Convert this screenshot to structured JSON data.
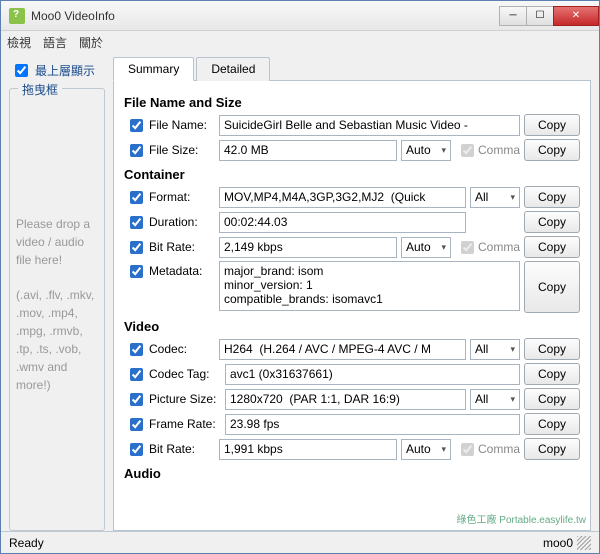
{
  "window": {
    "title": "Moo0 VideoInfo"
  },
  "menu": {
    "view": "檢視",
    "language": "語言",
    "about": "關於"
  },
  "sidebar": {
    "topmost": "最上層顯示",
    "dropframe_legend": "拖曳框",
    "drop_line1": "Please drop a video / audio file here!",
    "drop_line2": "(.avi, .flv, .mkv, .mov, .mp4, .mpg, .rmvb, .tp, .ts, .vob, .wmv and more!)"
  },
  "tabs": {
    "summary": "Summary",
    "detailed": "Detailed"
  },
  "labels": {
    "copy": "Copy",
    "comma": "Comma",
    "auto": "Auto",
    "all": "All",
    "file_section": "File Name and Size",
    "file_name": "File Name:",
    "file_size": "File Size:",
    "container_section": "Container",
    "format": "Format:",
    "duration": "Duration:",
    "bitrate": "Bit Rate:",
    "metadata": "Metadata:",
    "video_section": "Video",
    "codec": "Codec:",
    "codec_tag": "Codec Tag:",
    "picture_size": "Picture Size:",
    "frame_rate": "Frame Rate:",
    "audio_section": "Audio"
  },
  "values": {
    "file_name": "SuicideGirl Belle and Sebastian Music Video -",
    "file_size": "42.0 MB",
    "format": "MOV,MP4,M4A,3GP,3G2,MJ2  (Quick",
    "duration": "00:02:44.03",
    "container_bitrate": "2,149 kbps",
    "metadata": "major_brand: isom\nminor_version: 1\ncompatible_brands: isomavc1",
    "codec": "H264  (H.264 / AVC / MPEG-4 AVC / M",
    "codec_tag": "avc1 (0x31637661)",
    "picture_size": "1280x720  (PAR 1:1, DAR 16:9)",
    "frame_rate": "23.98 fps",
    "video_bitrate": "1,991 kbps"
  },
  "status": {
    "left": "Ready",
    "right": "moo0"
  },
  "watermark": "綠色工廠 Portable.easylife.tw"
}
